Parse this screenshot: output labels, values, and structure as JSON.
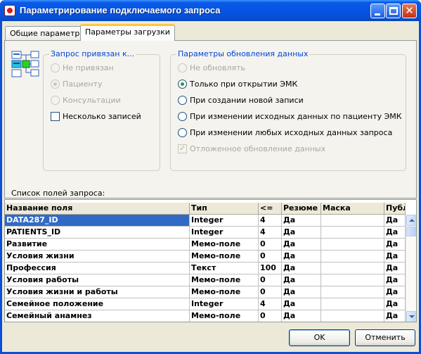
{
  "window": {
    "title": "Параметрирование подключаемого запроса"
  },
  "tabs": [
    {
      "label": "Общие параметры",
      "active": false
    },
    {
      "label": "Параметры загрузки",
      "active": true
    }
  ],
  "bind_group": {
    "title": "Запрос привязан к...",
    "options": [
      {
        "label": "Не привязан",
        "checked": false,
        "enabled": false
      },
      {
        "label": "Пациенту",
        "checked": true,
        "enabled": false
      },
      {
        "label": "Консультации",
        "checked": false,
        "enabled": false
      }
    ],
    "multiple_records": {
      "label": "Несколько записей",
      "checked": false,
      "enabled": true
    }
  },
  "update_group": {
    "title": "Параметры обновления данных",
    "options": [
      {
        "label": "Не обновлять",
        "checked": false,
        "enabled": false
      },
      {
        "label": "Только при открытии ЭМК",
        "checked": true,
        "enabled": true
      },
      {
        "label": "При создании новой записи",
        "checked": false,
        "enabled": true
      },
      {
        "label": "При изменении исходных данных по пациенту ЭМК",
        "checked": false,
        "enabled": true
      },
      {
        "label": "При изменении любых исходных данных запроса",
        "checked": false,
        "enabled": true
      }
    ],
    "deferred": {
      "label": "Отложенное обновление данных",
      "checked": true,
      "enabled": false
    }
  },
  "fields": {
    "caption": "Список полей запроса:",
    "columns": [
      "Название поля",
      "Тип",
      "<=",
      "Резюме",
      "Маска",
      "Публ"
    ],
    "rows": [
      [
        "DATA287_ID",
        "Integer",
        "4",
        "Да",
        "",
        "Да"
      ],
      [
        "PATIENTS_ID",
        "Integer",
        "4",
        "Да",
        "",
        "Да"
      ],
      [
        "Развитие",
        "Мемо-поле",
        "0",
        "Да",
        "",
        "Да"
      ],
      [
        "Условия жизни",
        "Мемо-поле",
        "0",
        "Да",
        "",
        "Да"
      ],
      [
        "Профессия",
        "Текст",
        "100",
        "Да",
        "",
        "Да"
      ],
      [
        "Условия работы",
        "Мемо-поле",
        "0",
        "Да",
        "",
        "Да"
      ],
      [
        "Условия жизни и работы",
        "Мемо-поле",
        "0",
        "Да",
        "",
        "Да"
      ],
      [
        "Семейное положение",
        "Integer",
        "4",
        "Да",
        "",
        "Да"
      ],
      [
        "Семейный анамнез",
        "Мемо-поле",
        "0",
        "Да",
        "",
        "Да"
      ]
    ],
    "selected_row": 0
  },
  "buttons": {
    "ok": "OK",
    "cancel": "Отменить"
  },
  "colors": {
    "titlebar": "#0654e2",
    "group_title": "#0046d5",
    "selection": "#316ac5",
    "radio_dot": "#21a121"
  }
}
